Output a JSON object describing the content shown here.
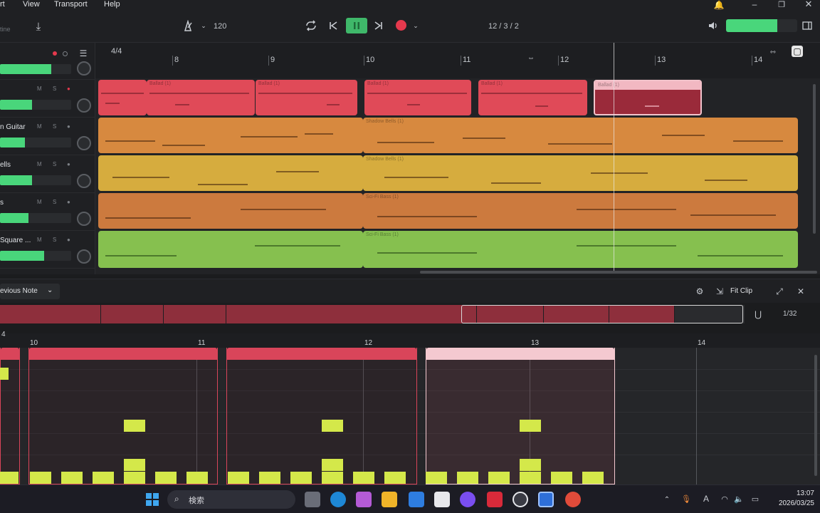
{
  "menu": {
    "items": [
      "rt",
      "View",
      "Transport",
      "Help"
    ]
  },
  "toolbar": {
    "tempo": "120",
    "position": "12 / 3 / 2",
    "left_label": "tine"
  },
  "colors": {
    "accent": "#3fb86a",
    "record": "#e5394d",
    "drums": "#e04a58",
    "guitar": "#d7893f",
    "bells": "#d6ac3e",
    "bass": "#cc7a3e",
    "square": "#86c04f",
    "note": "#d4e84a"
  },
  "tracks": [
    {
      "name": "",
      "level": 0.72,
      "color": "#e04a58"
    },
    {
      "name": "",
      "level": 0.55,
      "color": "#e04a58"
    },
    {
      "name": "n Guitar",
      "level": 0.4,
      "color": "#d7893f"
    },
    {
      "name": "ells",
      "level": 0.45,
      "color": "#d6ac3e"
    },
    {
      "name": "s",
      "level": 0.4,
      "color": "#cc7a3e"
    },
    {
      "name": "Square ...",
      "level": 0.62,
      "color": "#86c04f"
    }
  ],
  "ruler": {
    "time_sig": "4/4",
    "bars": [
      "8",
      "9",
      "10",
      "11",
      "12",
      "13",
      "14"
    ]
  },
  "clips": {
    "drums": [
      "Ballad (1)",
      "Ballad (1)",
      "Ballad (1)",
      "Ballad (1)",
      "Ballad (1)",
      "Ballad (1)"
    ],
    "guitar": "Shadow Bells (1)",
    "bells": "Shadow Bells (1)",
    "bass": "Sci-Fi Bass (1)",
    "square": "Sci-Fi Bass (1)"
  },
  "piano_roll": {
    "mode_label": "evious Note",
    "fit_clip": "Fit Clip",
    "grid": "1/32",
    "bars": [
      "4",
      "10",
      "11",
      "12",
      "13",
      "14"
    ]
  },
  "taskbar": {
    "search": "検索",
    "time": "13:07",
    "date": "2026/03/25"
  }
}
